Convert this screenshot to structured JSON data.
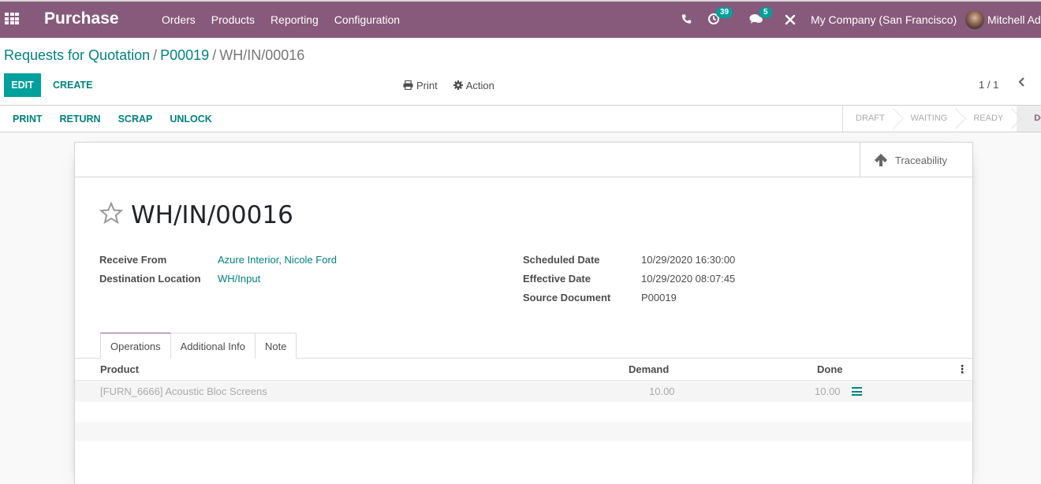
{
  "navbar": {
    "app_name": "Purchase",
    "menu": [
      "Orders",
      "Products",
      "Reporting",
      "Configuration"
    ],
    "systray": {
      "phone_icon": "phone-icon",
      "activity_count": "39",
      "messages_count": "5",
      "tools_icon": "tools-icon"
    },
    "company": "My Company (San Francisco)",
    "user": "Mitchell Admin"
  },
  "breadcrumb": {
    "items": [
      "Requests for Quotation",
      "P00019"
    ],
    "current": "WH/IN/00016",
    "separator": "/"
  },
  "control": {
    "edit_label": "EDIT",
    "create_label": "CREATE",
    "print_label": "Print",
    "action_label": "Action",
    "pager": "1 / 1"
  },
  "header_buttons": [
    "PRINT",
    "RETURN",
    "SCRAP",
    "UNLOCK"
  ],
  "stages": [
    {
      "label": "DRAFT",
      "active": false
    },
    {
      "label": "WAITING",
      "active": false
    },
    {
      "label": "READY",
      "active": false
    },
    {
      "label": "DONE",
      "active": true
    }
  ],
  "smart_button": {
    "label": "Traceability",
    "icon": "arrow-up-icon"
  },
  "record": {
    "title": "WH/IN/00016",
    "left_fields": [
      {
        "label": "Receive From",
        "value": "Azure Interior, Nicole Ford",
        "link": true
      },
      {
        "label": "Destination Location",
        "value": "WH/Input",
        "link": true
      }
    ],
    "right_fields": [
      {
        "label": "Scheduled Date",
        "value": "10/29/2020 16:30:00",
        "link": false
      },
      {
        "label": "Effective Date",
        "value": "10/29/2020 08:07:45",
        "link": false
      },
      {
        "label": "Source Document",
        "value": "P00019",
        "link": false
      }
    ]
  },
  "tabs": [
    {
      "label": "Operations",
      "active": true
    },
    {
      "label": "Additional Info",
      "active": false
    },
    {
      "label": "Note",
      "active": false
    }
  ],
  "operations": {
    "columns": [
      "Product",
      "Demand",
      "Done"
    ],
    "rows": [
      {
        "product": "[FURN_6666] Acoustic Bloc Screens",
        "demand": "10.00",
        "done": "10.00"
      }
    ]
  },
  "colors": {
    "brand": "#875a7b",
    "accent": "#00a09d",
    "link": "#00827f"
  }
}
